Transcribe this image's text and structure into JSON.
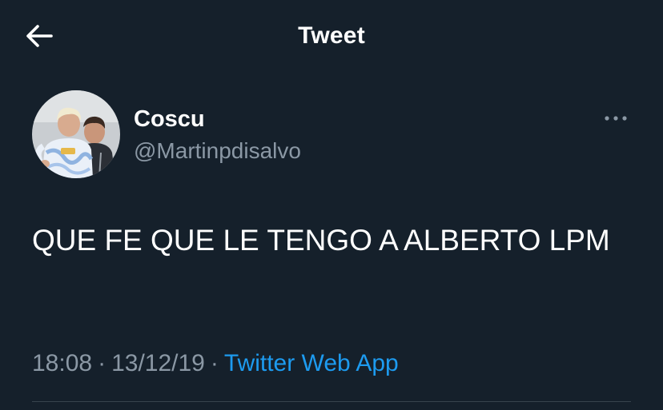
{
  "header": {
    "title": "Tweet",
    "back_icon": "arrow-left-icon"
  },
  "author": {
    "display_name": "Coscu",
    "handle": "@Martinpdisalvo",
    "avatar_icon": "profile-photo"
  },
  "tweet": {
    "text": "QUE FE QUE LE TENGO A ALBERTO LPM",
    "time": "18:08",
    "date": "13/12/19",
    "separator": "·",
    "source": "Twitter Web App"
  },
  "menu": {
    "more_icon": "more-horizontal-icon"
  },
  "colors": {
    "background": "#15202b",
    "primary_text": "#ffffff",
    "secondary_text": "#8b98a5",
    "link": "#1d9bf0",
    "divider": "#38444d"
  }
}
